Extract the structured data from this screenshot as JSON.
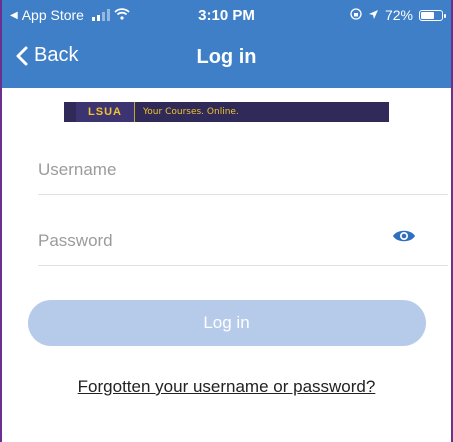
{
  "status_bar": {
    "back_app": "App Store",
    "time": "3:10 PM",
    "battery": "72%",
    "battery_level": 0.72,
    "icons": [
      "back-arrow-icon",
      "signal-icon",
      "wifi-icon",
      "lock-rotation-icon",
      "location-icon",
      "battery-icon"
    ]
  },
  "nav": {
    "back_label": "Back",
    "title": "Log in"
  },
  "banner": {
    "logo_text": "LSUA",
    "tagline": "Your Courses. Online."
  },
  "form": {
    "username_placeholder": "Username",
    "password_placeholder": "Password",
    "login_label": "Log in",
    "forgot_label": "Forgotten your username or password?"
  },
  "colors": {
    "header": "#3f7fc8",
    "button_disabled": "#b6cbe9",
    "eye_icon": "#2f6fc0",
    "frame_border": "#6b2f8f"
  }
}
